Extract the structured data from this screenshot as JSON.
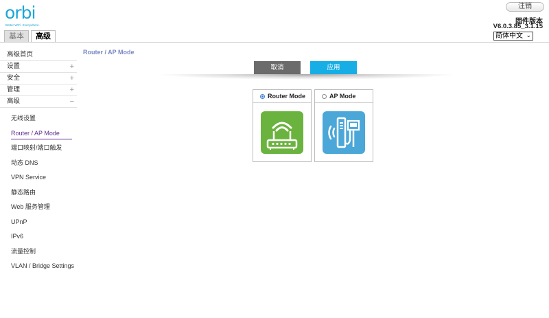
{
  "brand": {
    "name": "orbi",
    "tagline": "Better WiFi. Everywhere."
  },
  "tabs": [
    {
      "label": "基本",
      "active": false
    },
    {
      "label": "高级",
      "active": true
    }
  ],
  "header": {
    "logout_label": "注销",
    "firmware_label": "固件版本",
    "firmware_version": "V6.0.3.85_3.1.15",
    "language_selected": "简体中文"
  },
  "sidebar": {
    "sections": [
      {
        "label": "高级首页",
        "sign": ""
      },
      {
        "label": "设置",
        "sign": "+"
      },
      {
        "label": "安全",
        "sign": "+"
      },
      {
        "label": "管理",
        "sign": "+"
      },
      {
        "label": "高级",
        "sign": "−"
      }
    ],
    "sub_items": [
      {
        "label": "无线设置",
        "active": false
      },
      {
        "label": "Router / AP Mode",
        "active": true
      },
      {
        "label": "端口映射/端口触发",
        "active": false
      },
      {
        "label": "动态 DNS",
        "active": false
      },
      {
        "label": "VPN Service",
        "active": false
      },
      {
        "label": "静态路由",
        "active": false
      },
      {
        "label": "Web 服务管理",
        "active": false
      },
      {
        "label": "UPnP",
        "active": false
      },
      {
        "label": "IPv6",
        "active": false
      },
      {
        "label": "流量控制",
        "active": false
      },
      {
        "label": "VLAN / Bridge Settings",
        "active": false
      }
    ]
  },
  "main": {
    "title": "Router / AP Mode",
    "cancel_label": "取消",
    "apply_label": "应用",
    "modes": [
      {
        "label": "Router Mode",
        "selected": true,
        "icon": "router-icon",
        "color": "#6bb33f"
      },
      {
        "label": "AP Mode",
        "selected": false,
        "icon": "access-point-icon",
        "color": "#4aa7d8"
      }
    ]
  },
  "colors": {
    "accent_blue": "#17aee6",
    "active_purple": "#5c2d91",
    "title_blue": "#7a87c4"
  }
}
